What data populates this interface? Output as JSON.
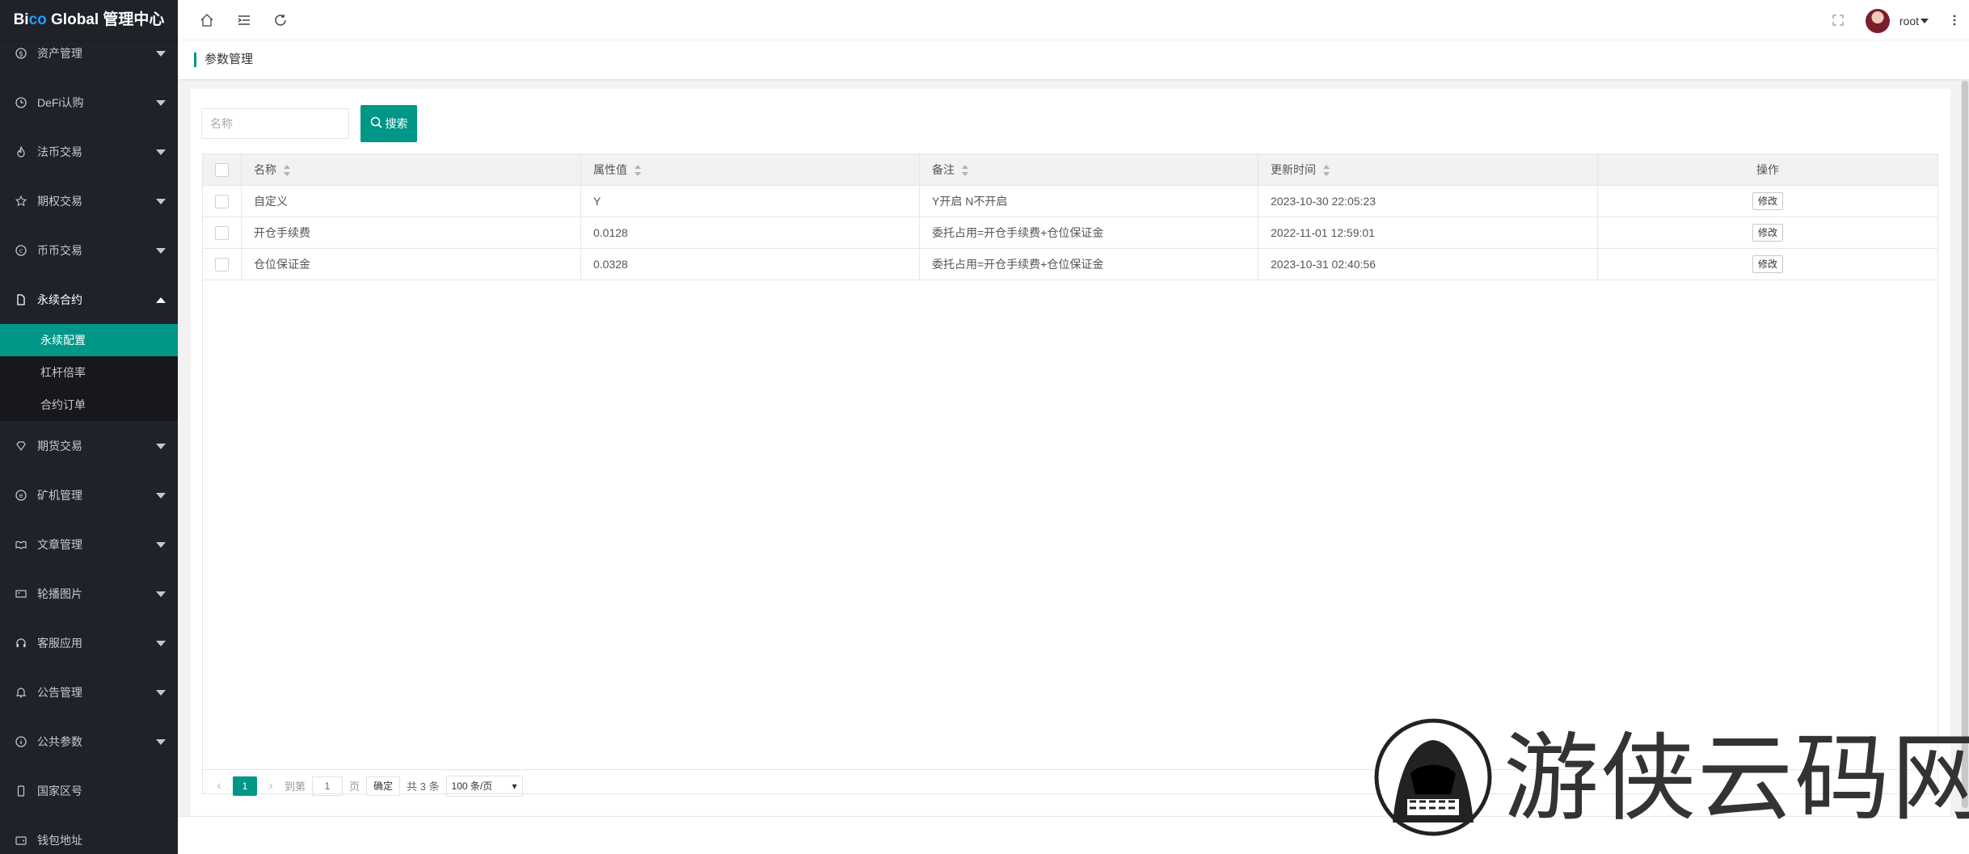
{
  "app": {
    "logo_pre": "Bi",
    "logo_co": "co",
    "logo_post": " Global 管理中心"
  },
  "sidebar": {
    "items": [
      {
        "label": "资产管理",
        "icon": "dollar-icon"
      },
      {
        "label": "DeFi认购",
        "icon": "clock-icon"
      },
      {
        "label": "法币交易",
        "icon": "fire-icon"
      },
      {
        "label": "期权交易",
        "icon": "star-icon"
      },
      {
        "label": "币币交易",
        "icon": "exchange-icon"
      },
      {
        "label": "永续合约",
        "icon": "file-icon"
      },
      {
        "label": "期货交易",
        "icon": "diamond-icon"
      },
      {
        "label": "矿机管理",
        "icon": "ether-icon"
      },
      {
        "label": "文章管理",
        "icon": "read-icon"
      },
      {
        "label": "轮播图片",
        "icon": "image-icon"
      },
      {
        "label": "客服应用",
        "icon": "headset-icon"
      },
      {
        "label": "公告管理",
        "icon": "bell-icon"
      },
      {
        "label": "公共参数",
        "icon": "info-icon"
      },
      {
        "label": "国家区号",
        "icon": "phone-icon"
      },
      {
        "label": "钱包地址",
        "icon": "wallet-icon"
      }
    ],
    "submenu": [
      "永续配置",
      "杠杆倍率",
      "合约订单"
    ]
  },
  "header": {
    "username": "root"
  },
  "tab": {
    "title": "参数管理"
  },
  "search": {
    "placeholder": "名称",
    "button_label": "搜索"
  },
  "table": {
    "columns": [
      "名称",
      "属性值",
      "备注",
      "更新时间",
      "操作"
    ],
    "rows": [
      {
        "name": "自定义",
        "value": "Y",
        "note": "Y开启 N不开启",
        "time": "2023-10-30 22:05:23",
        "action": "修改"
      },
      {
        "name": "开仓手续费",
        "value": "0.0128",
        "note": "委托占用=开仓手续费+仓位保证金",
        "time": "2022-11-01 12:59:01",
        "action": "修改"
      },
      {
        "name": "仓位保证金",
        "value": "0.0328",
        "note": "委托占用=开仓手续费+仓位保证金",
        "time": "2023-10-31 02:40:56",
        "action": "修改"
      }
    ]
  },
  "pager": {
    "current": "1",
    "goto_label": "到第",
    "goto_value": "1",
    "page_label": "页",
    "confirm_label": "确定",
    "total_label": "共 3 条",
    "page_size": "100 条/页"
  },
  "watermark": {
    "text": "游侠云码网"
  },
  "colors": {
    "primary": "#009688",
    "sidebar": "#20222a",
    "logo_accent": "#1e9fff"
  }
}
